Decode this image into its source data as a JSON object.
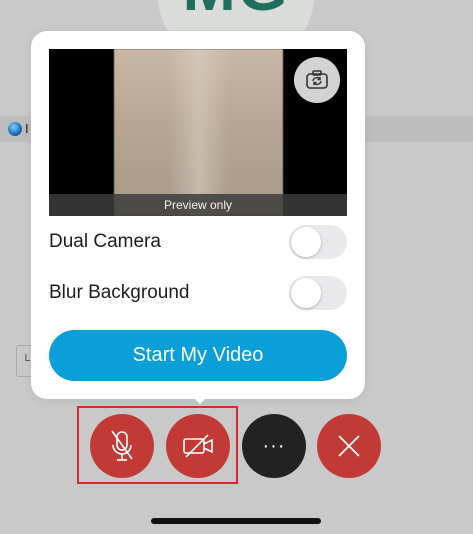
{
  "background": {
    "avatar_initials": "MG"
  },
  "video_popover": {
    "preview_caption": "Preview only",
    "switch_camera_icon": "camera-rotate-icon",
    "dual_camera": {
      "label": "Dual Camera",
      "on": false
    },
    "blur_background": {
      "label": "Blur Background",
      "on": false
    },
    "start_button_label": "Start My Video"
  },
  "controls": {
    "mute_icon": "mic-off-icon",
    "video_icon": "video-off-icon",
    "more_icon": "more-dots-icon",
    "end_icon": "close-icon",
    "more_label": "···"
  },
  "colors": {
    "control_red": "#c23a35",
    "control_dark": "#222222",
    "accent_blue": "#0a9fd8",
    "highlight": "#d62b2b"
  }
}
